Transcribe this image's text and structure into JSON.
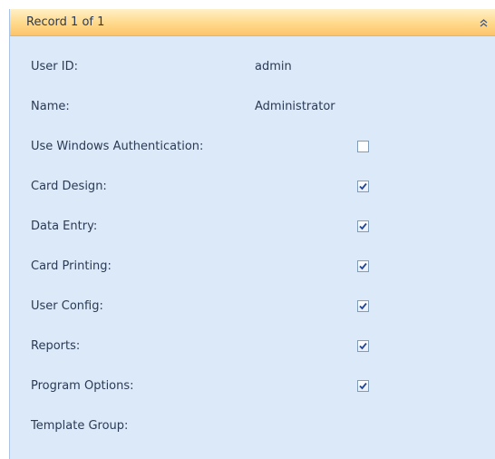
{
  "header": {
    "title": "Record 1 of 1",
    "collapse_icon": "double-chevron-up-icon"
  },
  "fields": [
    {
      "id": "user-id",
      "label": "User ID:",
      "type": "text",
      "value": "admin"
    },
    {
      "id": "name",
      "label": "Name:",
      "type": "text",
      "value": "Administrator"
    },
    {
      "id": "use-windows-authentication",
      "label": "Use Windows Authentication:",
      "type": "checkbox",
      "checked": false
    },
    {
      "id": "card-design",
      "label": "Card Design:",
      "type": "checkbox",
      "checked": true
    },
    {
      "id": "data-entry",
      "label": "Data Entry:",
      "type": "checkbox",
      "checked": true
    },
    {
      "id": "card-printing",
      "label": "Card Printing:",
      "type": "checkbox",
      "checked": true
    },
    {
      "id": "user-config",
      "label": "User Config:",
      "type": "checkbox",
      "checked": true
    },
    {
      "id": "reports",
      "label": "Reports:",
      "type": "checkbox",
      "checked": true
    },
    {
      "id": "program-options",
      "label": "Program Options:",
      "type": "checkbox",
      "checked": true
    },
    {
      "id": "template-group",
      "label": "Template Group:",
      "type": "text",
      "value": ""
    }
  ],
  "colors": {
    "panel_background": "#dce9f8",
    "header_gradient_top": "#fff0c7",
    "header_gradient_bottom": "#fcc46b",
    "checkmark": "#21459c"
  }
}
